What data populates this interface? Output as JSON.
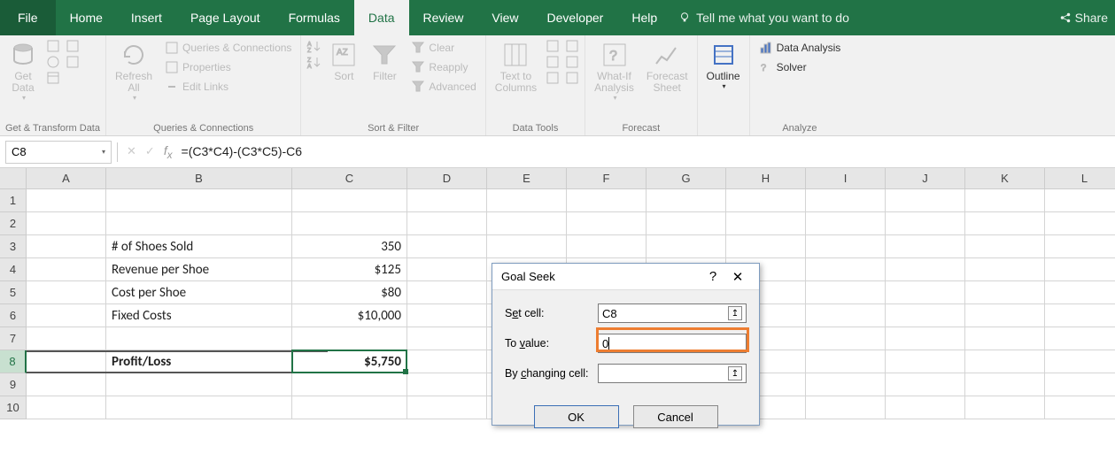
{
  "tabs": {
    "file": "File",
    "home": "Home",
    "insert": "Insert",
    "page_layout": "Page Layout",
    "formulas": "Formulas",
    "data": "Data",
    "review": "Review",
    "view": "View",
    "developer": "Developer",
    "help": "Help"
  },
  "tell_me": "Tell me what you want to do",
  "share": "Share",
  "ribbon": {
    "get_data": "Get\nData",
    "refresh_all": "Refresh\nAll",
    "queries": "Queries & Connections",
    "properties": "Properties",
    "edit_links": "Edit Links",
    "sort": "Sort",
    "filter": "Filter",
    "clear": "Clear",
    "reapply": "Reapply",
    "advanced": "Advanced",
    "text_to_columns": "Text to\nColumns",
    "what_if": "What-If\nAnalysis",
    "forecast_sheet": "Forecast\nSheet",
    "outline": "Outline",
    "data_analysis": "Data Analysis",
    "solver": "Solver",
    "group_labels": {
      "gtd": "Get & Transform Data",
      "qc": "Queries & Connections",
      "sf": "Sort & Filter",
      "dt": "Data Tools",
      "fc": "Forecast",
      "an": "Analyze"
    }
  },
  "name_box": "C8",
  "formula": "=(C3*C4)-(C3*C5)-C6",
  "columns": [
    "A",
    "B",
    "C",
    "D",
    "E",
    "F",
    "G",
    "H",
    "I",
    "J",
    "K",
    "L"
  ],
  "rows": [
    "1",
    "2",
    "3",
    "4",
    "5",
    "6",
    "7",
    "8",
    "9",
    "10"
  ],
  "sheet": {
    "b3": "# of Shoes Sold",
    "c3": "350",
    "b4": "Revenue per Shoe",
    "c4": "$125",
    "b5": "Cost per Shoe",
    "c5": "$80",
    "b6": "Fixed Costs",
    "c6": "$10,000",
    "b8": "Profit/Loss",
    "c8": "$5,750"
  },
  "dialog": {
    "title": "Goal Seek",
    "set_cell_pre": "S",
    "set_cell_u": "e",
    "set_cell_post": "t cell:",
    "to_value_pre": "To ",
    "to_value_u": "v",
    "to_value_post": "alue:",
    "by_pre": "By ",
    "by_u": "c",
    "by_post": "hanging cell:",
    "set_cell_val": "C8",
    "to_value_val": "0",
    "by_val": "",
    "ok": "OK",
    "cancel": "Cancel"
  }
}
